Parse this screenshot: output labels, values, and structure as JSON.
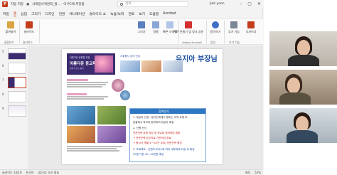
{
  "window": {
    "title_left": "자동 저장",
    "doc_title": "사회봉사위원회_발... · 이 PC에 저장됨",
    "search_placeholder": "검색",
    "user": "Jieh yoon"
  },
  "menu": {
    "items": [
      "파일",
      "홈",
      "삽입",
      "그리기",
      "디자인",
      "전환",
      "애니메이션",
      "슬라이드 쇼",
      "녹음/녹화",
      "검토",
      "보기",
      "도움말",
      "Acrobat"
    ],
    "active_index": 1
  },
  "ribbon": {
    "buttons": [
      "붙여넣기",
      "슬라이드",
      "그리기",
      "정렬",
      "빠른 스타일",
      "받아쓰기",
      "PDF 만들기 및 링크 공유",
      "받아쓰기",
      "추가 기능",
      "디자이너"
    ],
    "groups": [
      "클립보드",
      "슬라이드",
      "Adobe Acrobat",
      "음성",
      "추가 기능"
    ]
  },
  "thumbs": {
    "numbers": [
      "5",
      "6",
      "7",
      "8",
      "9"
    ],
    "selected_index": 2
  },
  "slide": {
    "hero_small": "아름다운 동행을 위한",
    "hero_title": "아름다운 동교육",
    "hero_sub": "함께 나누는 봉사",
    "header_small": "사회봉사 강의 안내",
    "name": "유지아 부장님",
    "box_header": "참여방식",
    "box_lines": [
      "1. 대상자 선정 : 봉사단체에서 원하는 지역 요청 후",
      "   한울에서 학교와 협의하여 대상자 확정",
      "2. 진행 순서",
      "   전문인력 요청 작성 후 학교와 협의하여 확정",
      "   → 전문인력 참고자료 기반작업 완료",
      "   → 봉사자 역할(1~3시간 소요) 전문인력 협업",
      "3. 프로젝트 : 컨텐츠서비스에 따라 세부과제 작성 후 확정",
      "   20명 기준 30~40만원 예상"
    ]
  },
  "status": {
    "slide": "슬라이드 14/19",
    "lang": "한국어",
    "access": "접근성: 조사 필요",
    "notes": "메모",
    "zoom": "53%"
  }
}
